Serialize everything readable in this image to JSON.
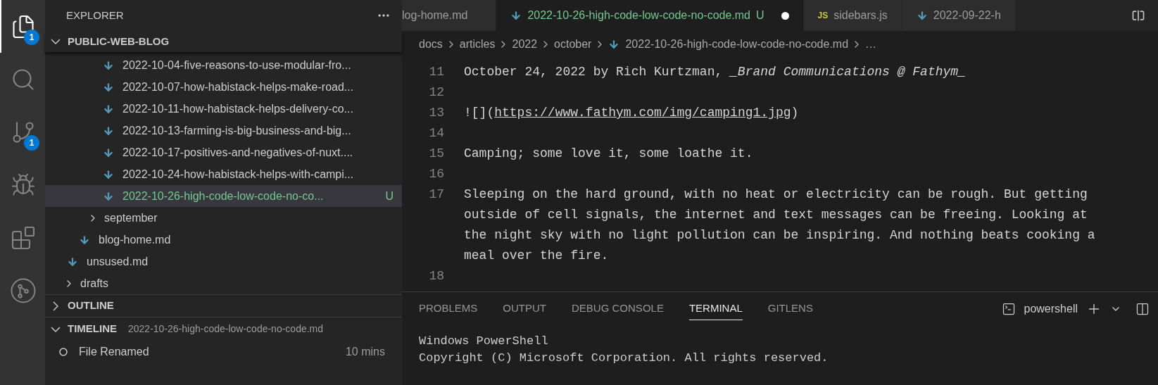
{
  "activity_bar": [
    {
      "kind": "files",
      "badge": "1",
      "selected": true
    },
    {
      "kind": "search",
      "selected": false
    },
    {
      "kind": "source-control",
      "badge": "1",
      "selected": false
    },
    {
      "kind": "run-debug",
      "selected": false
    },
    {
      "kind": "extensions",
      "selected": false
    },
    {
      "kind": "git-graph",
      "selected": false
    }
  ],
  "sidebar": {
    "title": "EXPLORER",
    "root": {
      "label": "PUBLIC-WEB-BLOG",
      "expanded": true,
      "children": [
        {
          "children": [
            {
              "children": [
                {
                  "children": [
                    {
                      "label": "2022-10-04-five-reasons-to-use-modular-fro...",
                      "kind": "file",
                      "selected": false
                    },
                    {
                      "label": "2022-10-07-how-habistack-helps-make-road...",
                      "kind": "file",
                      "selected": false
                    },
                    {
                      "label": "2022-10-11-how-habistack-helps-delivery-co...",
                      "kind": "file",
                      "selected": false
                    },
                    {
                      "label": "2022-10-13-farming-is-big-business-and-big...",
                      "kind": "file",
                      "selected": false
                    },
                    {
                      "label": "2022-10-17-positives-and-negatives-of-nuxt....",
                      "kind": "file",
                      "selected": false
                    },
                    {
                      "label": "2022-10-24-how-habistack-helps-with-campi...",
                      "kind": "file",
                      "selected": false
                    },
                    {
                      "label": "2022-10-26-high-code-low-code-no-co...",
                      "kind": "file",
                      "selected": true,
                      "status": "U"
                    }
                  ]
                },
                {
                  "label": "september",
                  "kind": "folder",
                  "expanded": false,
                  "selected": false
                }
              ]
            },
            {
              "label": "blog-home.md",
              "kind": "file",
              "selected": false
            }
          ]
        },
        {
          "label": "unsused.md",
          "kind": "file",
          "selected": false
        },
        {
          "label": "drafts",
          "kind": "folder",
          "expanded": false,
          "selected": false
        }
      ]
    },
    "outline": {
      "label": "OUTLINE",
      "expanded": false
    },
    "timeline": {
      "label": "TIMELINE",
      "expanded": true,
      "file": "2022-10-26-high-code-low-code-no-code.md",
      "entries": [
        {
          "label": "File Renamed",
          "time": "10 mins"
        }
      ]
    }
  },
  "tabs": [
    {
      "label": "log-home.md",
      "kind": "plain",
      "selected": false
    },
    {
      "label": "2022-10-26-high-code-low-code-no-code.md",
      "kind": "markdown",
      "selected": true,
      "status": "U",
      "dirty": true
    },
    {
      "label": "sidebars.js",
      "kind": "js",
      "icon_text": "JS",
      "selected": false
    },
    {
      "label": "2022-09-22-h",
      "kind": "markdown",
      "selected": false
    }
  ],
  "breadcrumbs": [
    {
      "label": "docs",
      "kind": "folder"
    },
    {
      "label": "articles",
      "kind": "folder"
    },
    {
      "label": "2022",
      "kind": "folder"
    },
    {
      "label": "october",
      "kind": "folder"
    },
    {
      "label": "2022-10-26-high-code-low-code-no-code.md",
      "kind": "file"
    },
    {
      "label": "…",
      "kind": "more"
    }
  ],
  "editor": {
    "lines": [
      {
        "number": "11",
        "text": "October 24, 2022 by Rich Kurtzman, *_Brand Communications @ Fathym_*"
      },
      {
        "number": "12"
      },
      {
        "number": "13",
        "text": "![](",
        "link": "https://www.fathym.com/img/camping1.jpg",
        "after": ")"
      },
      {
        "number": "14"
      },
      {
        "number": "15",
        "text": "Camping; some love it, some loathe it."
      },
      {
        "number": "16"
      },
      {
        "number": "17",
        "text": "Sleeping on the hard ground, with no heat or electricity can be rough. But getting outside of cell signals, the internet and text messages can be freeing. Looking at the night sky with no light pollution can be inspiring. And nothing beats cooking a meal over the fire."
      },
      {
        "number": "18"
      }
    ]
  },
  "panel": {
    "tabs": [
      {
        "label": "PROBLEMS",
        "selected": false
      },
      {
        "label": "OUTPUT",
        "selected": false
      },
      {
        "label": "DEBUG CONSOLE",
        "selected": false
      },
      {
        "label": "TERMINAL",
        "selected": true
      },
      {
        "label": "GITLENS",
        "selected": false
      }
    ],
    "terminal_name": "powershell",
    "terminal_lines": [
      "Windows PowerShell",
      "Copyright (C) Microsoft Corporation. All rights reserved."
    ]
  }
}
